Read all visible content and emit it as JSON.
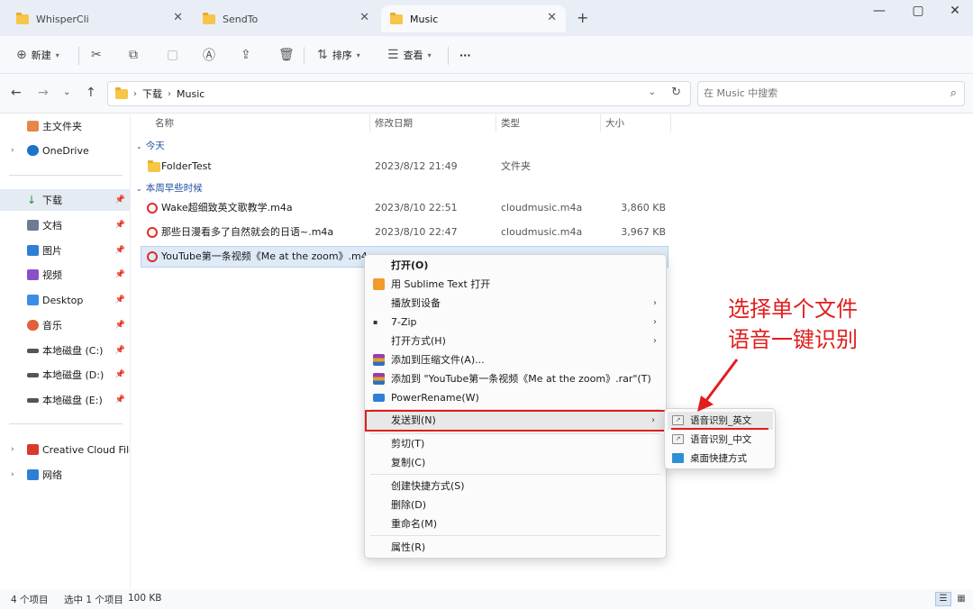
{
  "tabs": [
    {
      "label": "WhisperCli"
    },
    {
      "label": "SendTo"
    },
    {
      "label": "Music"
    }
  ],
  "window": {
    "minimize": "—",
    "maximize": "▢",
    "close": "✕",
    "new_tab": "+"
  },
  "toolbar": {
    "new_label": "新建",
    "sort_label": "排序",
    "view_label": "查看",
    "more_label": "···"
  },
  "address": {
    "crumbs": [
      "下载",
      "Music"
    ],
    "search_placeholder": "在 Music 中搜索"
  },
  "sidebar": {
    "items": [
      {
        "label": "主文件夹",
        "color": "#e8864a"
      },
      {
        "label": "OneDrive",
        "color": "#1e73c8"
      },
      {
        "label": "下载",
        "color": "#2b8a3e"
      },
      {
        "label": "文档",
        "color": "#6b7c93"
      },
      {
        "label": "图片",
        "color": "#2f7fd6"
      },
      {
        "label": "视频",
        "color": "#8a4fc9"
      },
      {
        "label": "Desktop",
        "color": "#3a8ee6"
      },
      {
        "label": "音乐",
        "color": "#e0613c"
      },
      {
        "label": "本地磁盘 (C:)",
        "color": "#555555"
      },
      {
        "label": "本地磁盘 (D:)",
        "color": "#555555"
      },
      {
        "label": "本地磁盘 (E:)",
        "color": "#555555"
      },
      {
        "label": "Creative Cloud Files",
        "color": "#d93a2b"
      },
      {
        "label": "网络",
        "color": "#2f7fd6"
      }
    ]
  },
  "columns": {
    "name": "名称",
    "modified": "修改日期",
    "type": "类型",
    "size": "大小"
  },
  "groups": {
    "today": "今天",
    "this_week": "本周早些时候"
  },
  "files": [
    {
      "name": "FolderTest",
      "modified": "2023/8/12 21:49",
      "type": "文件夹",
      "size": ""
    },
    {
      "name": "Wake超细致英文歌教学.m4a",
      "modified": "2023/8/10 22:51",
      "type": "cloudmusic.m4a",
      "size": "3,860 KB"
    },
    {
      "name": "那些日漫看多了自然就会的日语~.m4a",
      "modified": "2023/8/10 22:47",
      "type": "cloudmusic.m4a",
      "size": "3,967 KB"
    },
    {
      "name": "YouTube第一条视频《Me at the zoom》.m4a",
      "modified": "",
      "type": "",
      "size": ""
    }
  ],
  "status": {
    "count": "4 个项目",
    "selected": "选中 1 个项目",
    "size": "100 KB"
  },
  "context_menu": {
    "items": [
      {
        "label": "打开(O)"
      },
      {
        "label": "用 Sublime Text 打开"
      },
      {
        "label": "播放到设备"
      },
      {
        "label": "7-Zip"
      },
      {
        "label": "打开方式(H)"
      },
      {
        "label": "添加到压缩文件(A)..."
      },
      {
        "label": "添加到 \"YouTube第一条视频《Me at the zoom》.rar\"(T)"
      },
      {
        "label": "PowerRename(W)"
      },
      {
        "label": "发送到(N)"
      },
      {
        "label": "剪切(T)"
      },
      {
        "label": "复制(C)"
      },
      {
        "label": "创建快捷方式(S)"
      },
      {
        "label": "删除(D)"
      },
      {
        "label": "重命名(M)"
      },
      {
        "label": "属性(R)"
      }
    ]
  },
  "submenu": {
    "items": [
      {
        "label": "语音识别_英文"
      },
      {
        "label": "语音识别_中文"
      },
      {
        "label": "桌面快捷方式"
      }
    ]
  },
  "annotation": {
    "line1": "选择单个文件",
    "line2": "语音一键识别",
    "color": "#e11d1d"
  }
}
